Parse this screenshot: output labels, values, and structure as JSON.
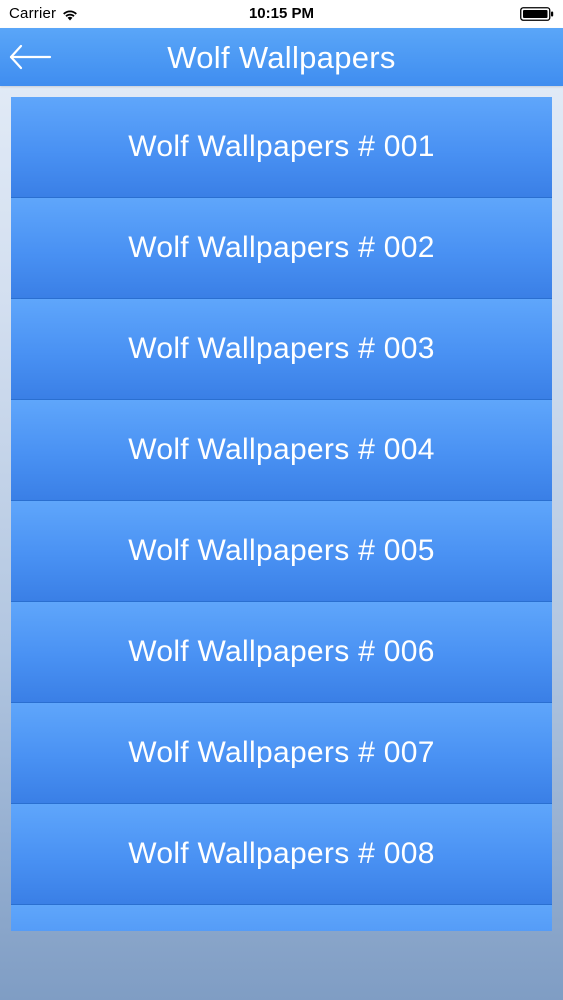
{
  "status_bar": {
    "carrier": "Carrier",
    "time": "10:15 PM",
    "wifi_icon": "wifi-icon",
    "battery_icon": "battery-icon"
  },
  "nav": {
    "title": "Wolf Wallpapers",
    "back_icon": "back-arrow-icon"
  },
  "list": {
    "items": [
      {
        "label": "Wolf Wallpapers # 001"
      },
      {
        "label": "Wolf Wallpapers # 002"
      },
      {
        "label": "Wolf Wallpapers # 003"
      },
      {
        "label": "Wolf Wallpapers # 004"
      },
      {
        "label": "Wolf Wallpapers # 005"
      },
      {
        "label": "Wolf Wallpapers # 006"
      },
      {
        "label": "Wolf Wallpapers # 007"
      },
      {
        "label": "Wolf Wallpapers # 008"
      }
    ]
  },
  "colors": {
    "nav_background": "#4a98f5",
    "item_background": "#4991f3",
    "text": "#ffffff"
  }
}
